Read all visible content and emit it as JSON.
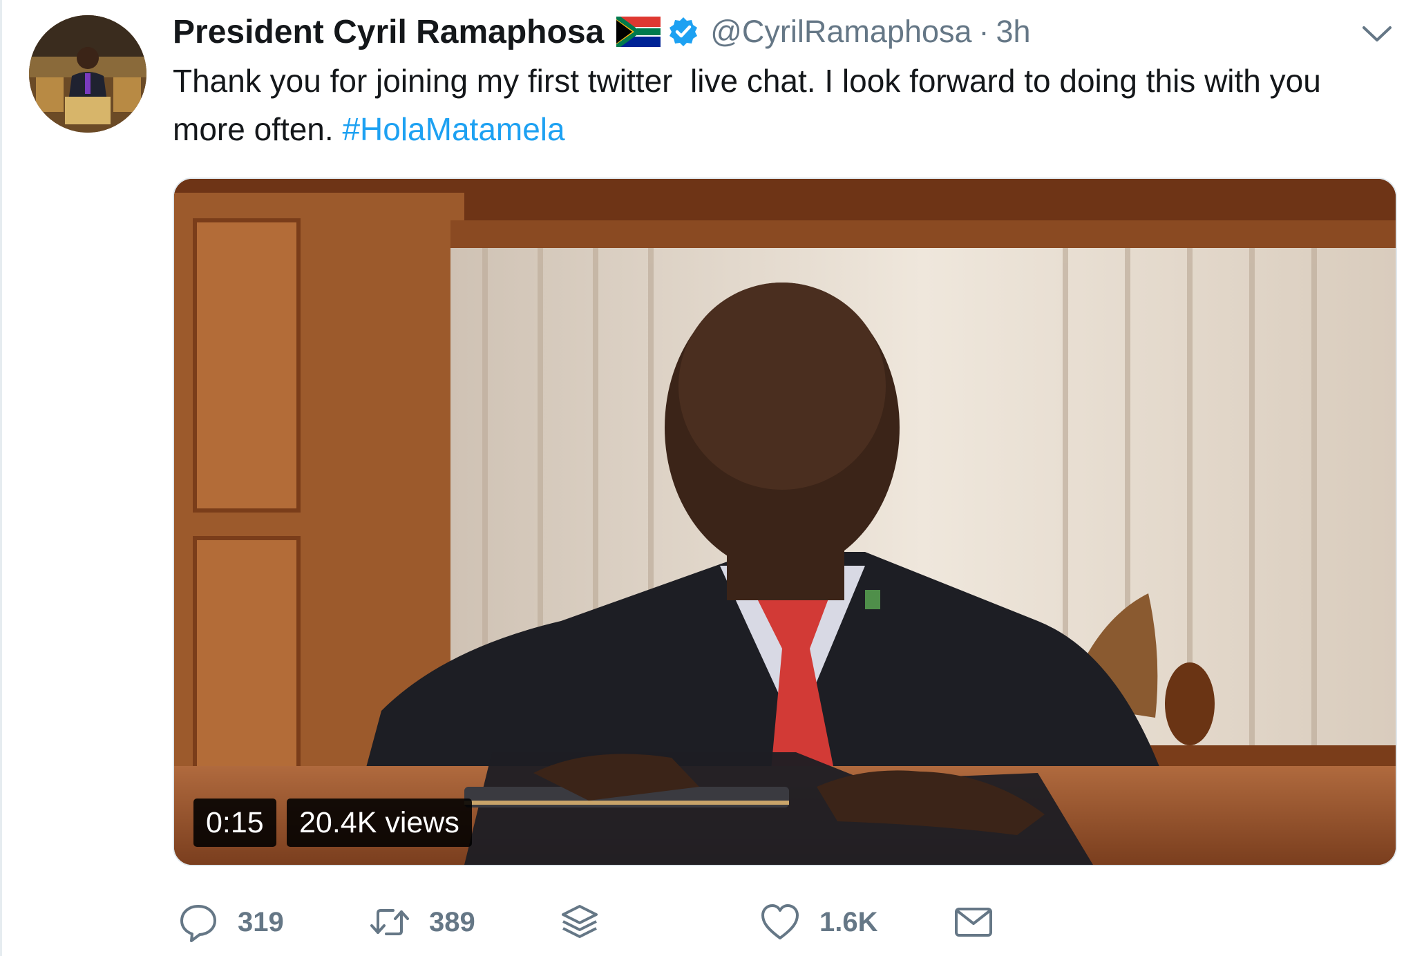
{
  "tweet": {
    "display_name": "President Cyril Ramaphosa",
    "handle": "@CyrilRamaphosa",
    "separator": "·",
    "time": "3h",
    "text_main": "Thank you for joining my first twitter  live chat. I look forward to doing this with you more often. ",
    "hashtag": "#HolaMatamela"
  },
  "media": {
    "duration": "0:15",
    "views": "20.4K views"
  },
  "actions": {
    "reply_count": "319",
    "retweet_count": "389",
    "like_count": "1.6K"
  },
  "colors": {
    "link": "#1da1f2",
    "verified": "#1da1f2",
    "muted": "#657786",
    "text": "#14171a"
  },
  "icons": [
    "avatar",
    "south-africa-flag-icon",
    "verified-badge-icon",
    "chevron-down-icon",
    "reply-icon",
    "retweet-icon",
    "stack-icon",
    "heart-icon",
    "mail-icon"
  ]
}
